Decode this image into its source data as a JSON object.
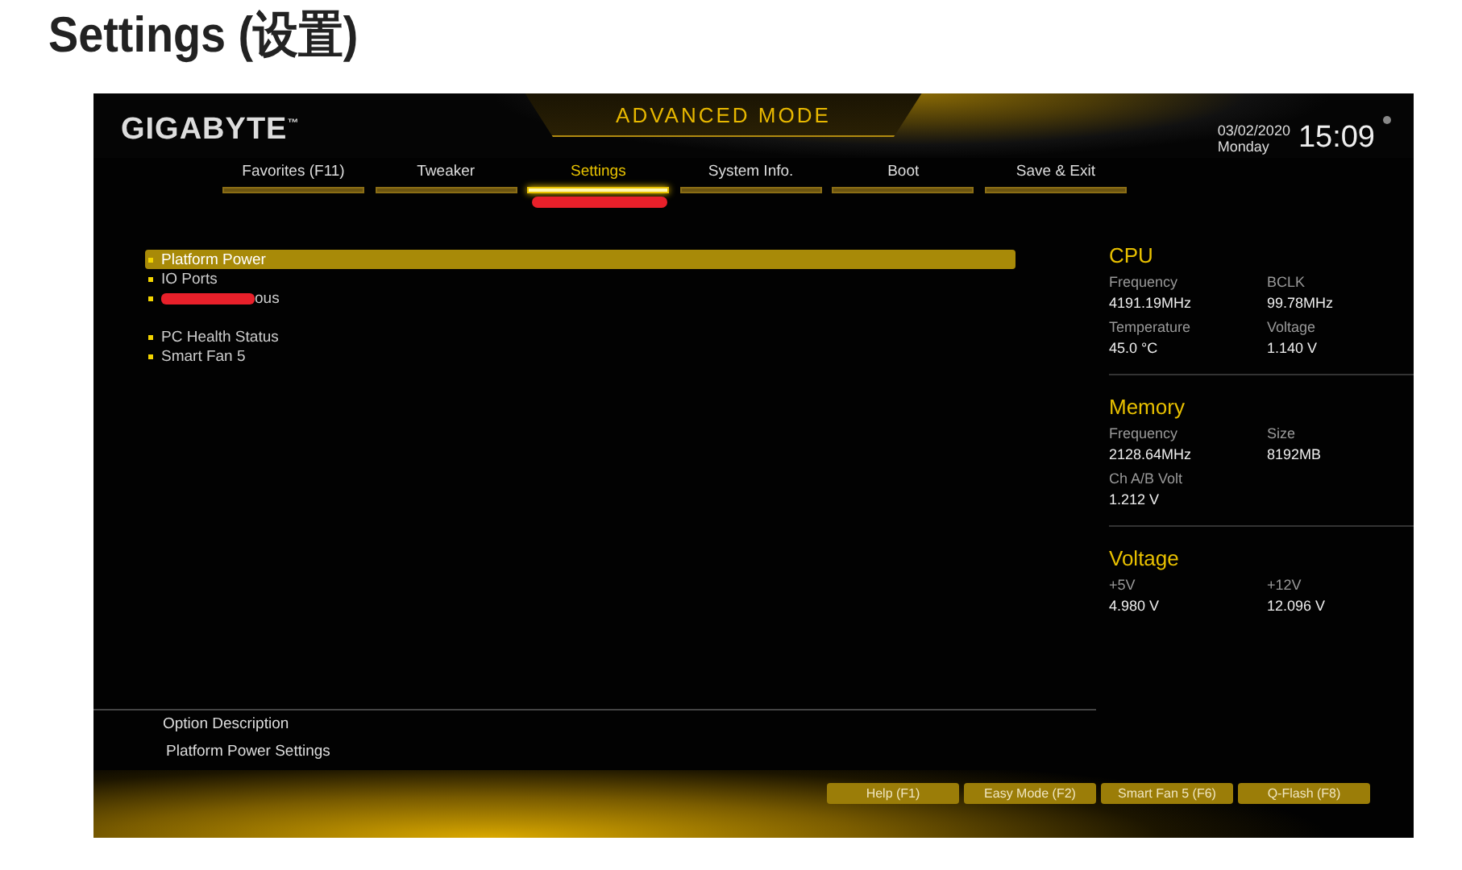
{
  "page_title": "Settings (设置)",
  "header": {
    "logo": "GIGABYTE$^{™}$",
    "mode": "ADVANCED MODE",
    "date": "03/02/2020",
    "day": "Monday",
    "time": "15:09"
  },
  "tabs": [
    {
      "label": "Favorites (F11)",
      "selected": false,
      "marked": false
    },
    {
      "label": "Tweaker",
      "selected": false,
      "marked": false
    },
    {
      "label": "Settings",
      "selected": true,
      "marked": true
    },
    {
      "label": "System Info.",
      "selected": false,
      "marked": false
    },
    {
      "label": "Boot",
      "selected": false,
      "marked": false
    },
    {
      "label": "Save & Exit",
      "selected": false,
      "marked": false
    }
  ],
  "menu": [
    {
      "label": "Platform Power",
      "selected": true,
      "kind": "item"
    },
    {
      "label": "IO Ports",
      "selected": false,
      "kind": "item"
    },
    {
      "label": "ous",
      "selected": false,
      "kind": "scribbled"
    },
    {
      "kind": "gap"
    },
    {
      "label": "PC Health Status",
      "selected": false,
      "kind": "item"
    },
    {
      "label": "Smart Fan 5",
      "selected": false,
      "kind": "item"
    }
  ],
  "info": [
    {
      "title": "CPU",
      "items": [
        {
          "label": "Frequency",
          "value": "4191.19MHz"
        },
        {
          "label": "BCLK",
          "value": "99.78MHz"
        },
        {
          "label": "Temperature",
          "value": "45.0 °C"
        },
        {
          "label": "Voltage",
          "value": "1.140 V"
        }
      ]
    },
    {
      "title": "Memory",
      "items": [
        {
          "label": "Frequency",
          "value": "2128.64MHz"
        },
        {
          "label": "Size",
          "value": "8192MB"
        },
        {
          "label": "Ch A/B Volt",
          "value": "1.212 V"
        }
      ]
    },
    {
      "title": "Voltage",
      "items": [
        {
          "label": "+5V",
          "value": "4.980 V"
        },
        {
          "label": "+12V",
          "value": "12.096 V"
        }
      ]
    }
  ],
  "description": {
    "title": "Option Description",
    "text": "Platform Power Settings"
  },
  "footer_buttons": [
    {
      "label": "Help (F1)"
    },
    {
      "label": "Easy Mode (F2)"
    },
    {
      "label": "Smart Fan 5 (F6)"
    },
    {
      "label": "Q-Flash (F8)"
    }
  ]
}
